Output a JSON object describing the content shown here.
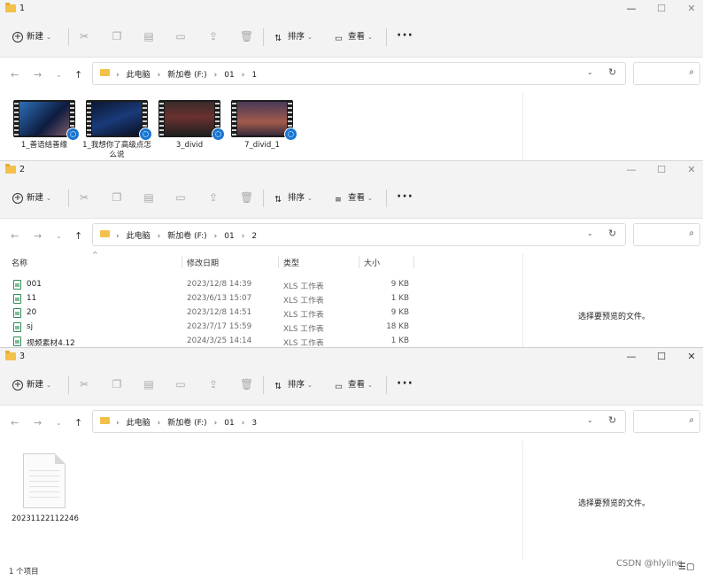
{
  "ribbon": {
    "new_label": "新建",
    "sort_label": "排序",
    "view_label": "查看",
    "more_label": "···"
  },
  "windows": {
    "w1": {
      "title": "1",
      "crumbs": [
        "此电脑",
        "新加卷 (F:)",
        "01",
        "1"
      ],
      "items": [
        {
          "label": "1_善语结善缘"
        },
        {
          "label": "1_我想你了高级点怎么说"
        },
        {
          "label": "3_divid"
        },
        {
          "label": "7_divid_1"
        }
      ]
    },
    "w2": {
      "title": "2",
      "crumbs": [
        "此电脑",
        "新加卷 (F:)",
        "01",
        "2"
      ],
      "columns": {
        "name": "名称",
        "date": "修改日期",
        "type": "类型",
        "size": "大小"
      },
      "rows": [
        {
          "name": "001",
          "date": "2023/12/8 14:39",
          "type": "XLS 工作表",
          "size": "9 KB"
        },
        {
          "name": "11",
          "date": "2023/6/13 15:07",
          "type": "XLS 工作表",
          "size": "1 KB"
        },
        {
          "name": "20",
          "date": "2023/12/8 14:51",
          "type": "XLS 工作表",
          "size": "9 KB"
        },
        {
          "name": "sj",
          "date": "2023/7/17 15:59",
          "type": "XLS 工作表",
          "size": "18 KB"
        },
        {
          "name": "视频素材4.12",
          "date": "2024/3/25 14:14",
          "type": "XLS 工作表",
          "size": "1 KB"
        }
      ],
      "preview_text": "选择要预览的文件。"
    },
    "w3": {
      "title": "3",
      "crumbs": [
        "此电脑",
        "新加卷 (F:)",
        "01",
        "3"
      ],
      "file_label": "20231122112246",
      "preview_text": "选择要预览的文件。",
      "status": "1 个项目",
      "watermark": "CSDN @hlylinq"
    }
  },
  "icons": [
    "folder-icon",
    "new-icon",
    "cut-icon",
    "copy-icon",
    "paste-icon",
    "rename-icon",
    "share-icon",
    "delete-icon",
    "sort-icon",
    "view-icon",
    "back-icon",
    "forward-icon",
    "recent-icon",
    "up-icon",
    "refresh-icon",
    "search-icon",
    "video-file-icon",
    "xls-file-icon",
    "document-file-icon"
  ]
}
